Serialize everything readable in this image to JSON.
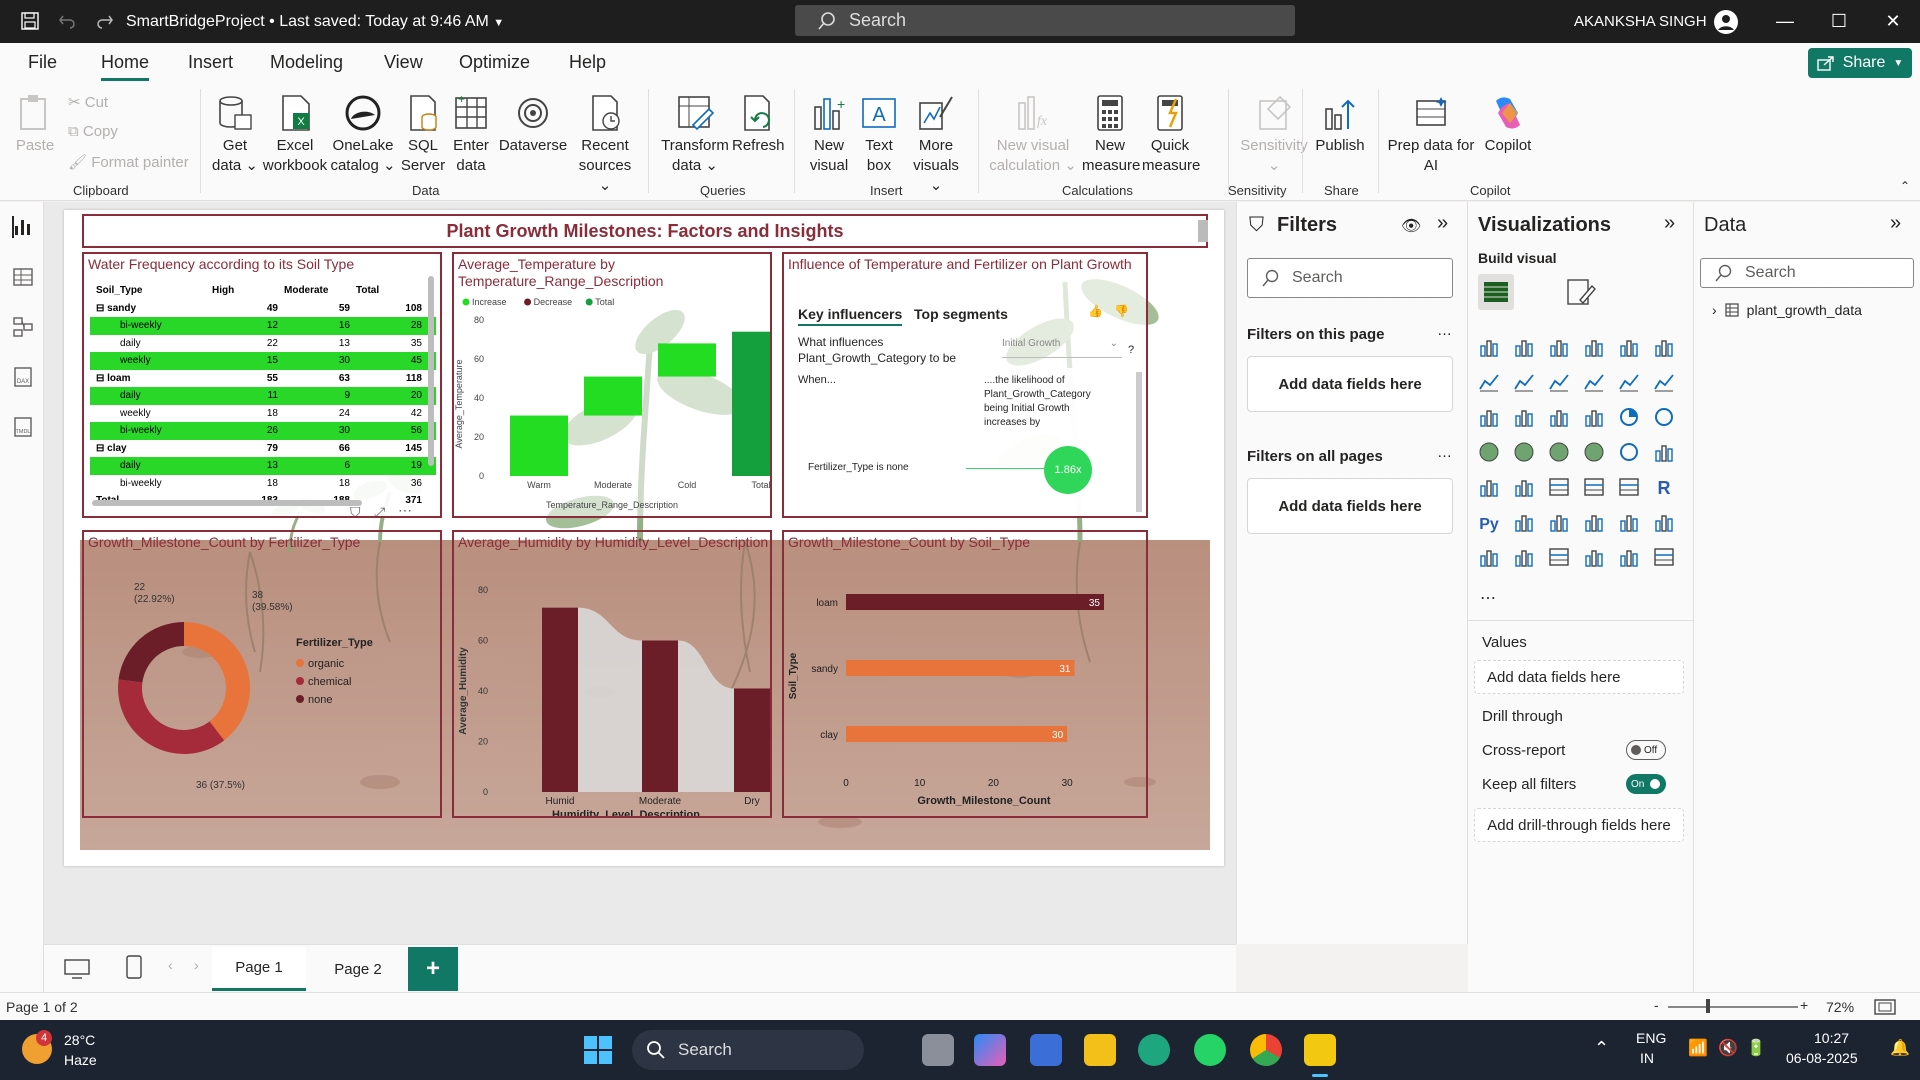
{
  "titlebar": {
    "title": "SmartBridgeProject • Last saved: Today at 9:46 AM",
    "search_placeholder": "Search",
    "user": "AKANKSHA SINGH"
  },
  "menu": [
    "File",
    "Home",
    "Insert",
    "Modeling",
    "View",
    "Optimize",
    "Help"
  ],
  "share_label": "Share",
  "clipboard": {
    "paste": "Paste",
    "cut": "Cut",
    "copy": "Copy",
    "format_painter": "Format painter",
    "group": "Clipboard"
  },
  "data_group": {
    "items": [
      {
        "l1": "Get",
        "l2": "data ⌄"
      },
      {
        "l1": "Excel",
        "l2": "workbook"
      },
      {
        "l1": "OneLake",
        "l2": "catalog ⌄"
      },
      {
        "l1": "SQL",
        "l2": "Server"
      },
      {
        "l1": "Enter",
        "l2": "data"
      },
      {
        "l1": "Dataverse",
        "l2": ""
      },
      {
        "l1": "Recent",
        "l2": "sources ⌄"
      }
    ],
    "group": "Data"
  },
  "queries_group": {
    "transform_1": "Transform",
    "transform_2": "data ⌄",
    "refresh": "Refresh",
    "group": "Queries"
  },
  "insert_group": {
    "new_visual_1": "New",
    "new_visual_2": "visual",
    "text_box_1": "Text",
    "text_box_2": "box",
    "more_1": "More",
    "more_2": "visuals ⌄",
    "group": "Insert"
  },
  "calc_group": {
    "nvc_1": "New visual",
    "nvc_2": "calculation ⌄",
    "nm_1": "New",
    "nm_2": "measure",
    "qm_1": "Quick",
    "qm_2": "measure",
    "group": "Calculations"
  },
  "sens_group": {
    "label": "Sensitivity",
    "caret": "⌄",
    "group": "Sensitivity"
  },
  "share_group": {
    "publish": "Publish",
    "group": "Share"
  },
  "copilot_group": {
    "prep_1": "Prep data for",
    "prep_2": "AI",
    "copilot": "Copilot",
    "group": "Copilot"
  },
  "report": {
    "title": "Plant Growth Milestones: Factors and Insights",
    "matrix": {
      "title": "Water Frequency according to its Soil Type",
      "headers": [
        "Soil_Type",
        "High",
        "Moderate",
        "Total"
      ],
      "rows": [
        {
          "label": "⊟  sandy",
          "high": "49",
          "moderate": "59",
          "total": "108",
          "type": "parent",
          "hl": false
        },
        {
          "label": "bi-weekly",
          "high": "12",
          "moderate": "16",
          "total": "28",
          "type": "sub",
          "hl": true
        },
        {
          "label": "daily",
          "high": "22",
          "moderate": "13",
          "total": "35",
          "type": "sub",
          "hl": false
        },
        {
          "label": "weekly",
          "high": "15",
          "moderate": "30",
          "total": "45",
          "type": "sub",
          "hl": true
        },
        {
          "label": "⊟  loam",
          "high": "55",
          "moderate": "63",
          "total": "118",
          "type": "parent",
          "hl": false
        },
        {
          "label": "daily",
          "high": "11",
          "moderate": "9",
          "total": "20",
          "type": "sub",
          "hl": true
        },
        {
          "label": "weekly",
          "high": "18",
          "moderate": "24",
          "total": "42",
          "type": "sub",
          "hl": false
        },
        {
          "label": "bi-weekly",
          "high": "26",
          "moderate": "30",
          "total": "56",
          "type": "sub",
          "hl": true
        },
        {
          "label": "⊟  clay",
          "high": "79",
          "moderate": "66",
          "total": "145",
          "type": "parent",
          "hl": false
        },
        {
          "label": "daily",
          "high": "13",
          "moderate": "6",
          "total": "19",
          "type": "sub",
          "hl": true
        },
        {
          "label": "bi-weekly",
          "high": "18",
          "moderate": "18",
          "total": "36",
          "type": "sub",
          "hl": false
        },
        {
          "label": "Total",
          "high": "183",
          "moderate": "188",
          "total": "371",
          "type": "total",
          "hl": false
        }
      ]
    },
    "waterfall_title": "Average_Temperature by Temperature_Range_Description",
    "key_inf": {
      "title": "Influence of Temperature and Fertilizer on Plant Growth",
      "tab1": "Key influencers",
      "tab2": "Top segments",
      "question": "What influences Plant_Growth_Category to be",
      "dropdown": "Initial Growth",
      "qmark": "?",
      "when": "When...",
      "likelihood": "....the likelihood of Plant_Growth_Category being Initial Growth increases by",
      "factor": "Fertilizer_Type is none",
      "factor_value": "1.86x"
    },
    "donut_title": "Growth_Milestone_Count by Fertilizer_Type",
    "humidity_title": "Average_Humidity by Humidity_Level_Description",
    "soil_title": "Growth_Milestone_Count by Soil_Type"
  },
  "chart_data": [
    {
      "type": "waterfall",
      "title": "Average_Temperature by Temperature_Range_Description",
      "categories": [
        "Warm",
        "Moderate",
        "Cold",
        "Total"
      ],
      "values": [
        31,
        20,
        17,
        74
      ],
      "legend": [
        "Increase",
        "Decrease",
        "Total"
      ],
      "xlabel": "Temperature_Range_Description",
      "ylabel": "Average_Temperature",
      "yticks": [
        "0",
        "20",
        "40",
        "60",
        "80"
      ],
      "ylim": [
        0,
        80
      ],
      "colors": {
        "increase": "#22dd22",
        "total": "#14a03c"
      }
    },
    {
      "type": "pie",
      "title": "Growth_Milestone_Count by Fertilizer_Type",
      "legend_title": "Fertilizer_Type",
      "categories": [
        "organic",
        "chemical",
        "none"
      ],
      "values": [
        38,
        36,
        22
      ],
      "labels": [
        "38\n(39.58%)",
        "36 (37.5%)",
        "22\n(22.92%)"
      ],
      "colors": [
        "#e8743b",
        "#a52a3a",
        "#6b1e28"
      ]
    },
    {
      "type": "bar",
      "title": "Average_Humidity by Humidity_Level_Description",
      "categories": [
        "Humid",
        "Moderate",
        "Dry"
      ],
      "values": [
        73,
        60,
        41
      ],
      "xlabel": "Humidity_Level_Description",
      "ylabel": "Average_Humidity",
      "yticks": [
        "0",
        "20",
        "40",
        "60",
        "80"
      ],
      "ylim": [
        0,
        80
      ],
      "color": "#6b1e28"
    },
    {
      "type": "bar",
      "orientation": "horizontal",
      "title": "Growth_Milestone_Count by Soil_Type",
      "categories": [
        "loam",
        "sandy",
        "clay"
      ],
      "values": [
        35,
        31,
        30
      ],
      "xlabel": "Growth_Milestone_Count",
      "ylabel": "Soil_Type",
      "xticks": [
        "0",
        "10",
        "20",
        "30"
      ],
      "xlim": [
        0,
        35
      ],
      "colors": [
        "#6b1e28",
        "#e8743b",
        "#e8743b"
      ]
    }
  ],
  "filters": {
    "title": "Filters",
    "search": "Search",
    "on_page": "Filters on this page",
    "on_all": "Filters on all pages",
    "add_fields": "Add data fields here",
    "more": "…"
  },
  "viz": {
    "title": "Visualizations",
    "build": "Build visual",
    "values": "Values",
    "add_fields": "Add data fields here",
    "drill": "Drill through",
    "cross_report": "Cross-report",
    "cross_state": "Off",
    "keep_filters": "Keep all filters",
    "keep_state": "On",
    "drill_add": "Add drill-through fields here",
    "more": "⋯",
    "r_label": "R",
    "py_label": "Py"
  },
  "data_pane": {
    "title": "Data",
    "search": "Search",
    "table": "plant_growth_data"
  },
  "pages": {
    "tab1": "Page 1",
    "tab2": "Page 2",
    "add": "+"
  },
  "status": {
    "page": "Page 1 of 2",
    "zoom": "72%",
    "minus": "-",
    "plus": "+"
  },
  "taskbar": {
    "temp": "28°C",
    "weather": "Haze",
    "badge": "4",
    "search": "Search",
    "lang1": "ENG",
    "lang2": "IN",
    "time": "10:27",
    "date": "06-08-2025"
  }
}
